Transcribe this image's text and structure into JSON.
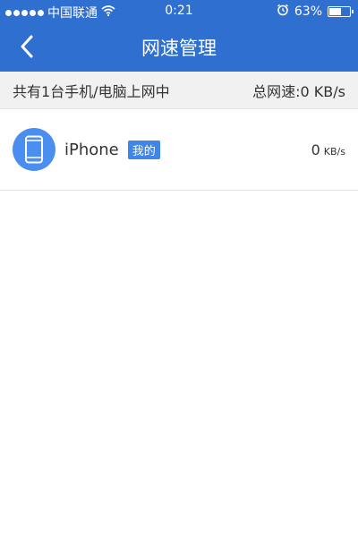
{
  "status_bar": {
    "carrier": "中国联通",
    "time": "0:21",
    "battery": "63%",
    "battery_level": 0.63,
    "icons": [
      "signal-dots-icon",
      "wifi-icon",
      "alarm-icon",
      "battery-icon"
    ]
  },
  "navbar": {
    "back_icon": "chevron-left-icon",
    "title": "网速管理"
  },
  "summary": {
    "device_count_text": "共有1台手机/电脑上网中",
    "total_speed_text": "总网速:0 KB/s"
  },
  "devices": [
    {
      "icon": "phone-icon",
      "name": "iPhone",
      "badge": "我的",
      "speed_value": "0",
      "speed_unit": "KB/s"
    }
  ],
  "colors": {
    "accent": "#2f6fcf",
    "avatar": "#4a8ff0",
    "badge": "#3e86e8"
  }
}
